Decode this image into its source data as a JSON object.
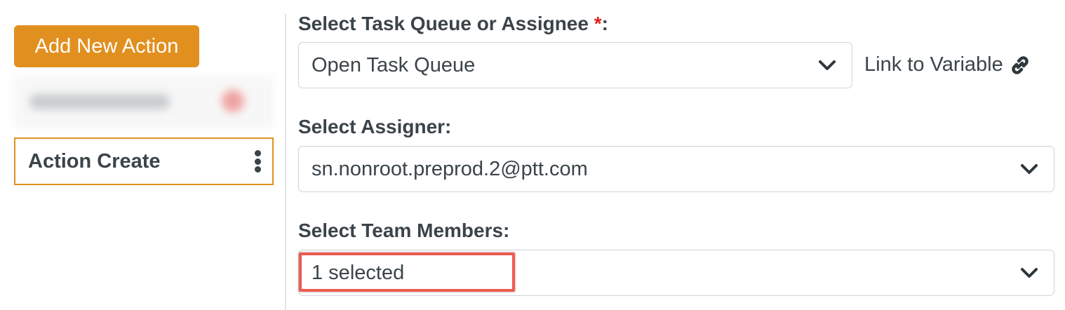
{
  "sidebar": {
    "add_button_label": "Add New Action",
    "selected_item_label": "Action Create"
  },
  "form": {
    "task_queue": {
      "label": "Select Task Queue or Assignee",
      "required_marker": "*",
      "label_suffix": ":",
      "value": "Open Task Queue",
      "link_label": "Link to Variable"
    },
    "assigner": {
      "label": "Select Assigner:",
      "value": "sn.nonroot.preprod.2@ptt.com"
    },
    "team_members": {
      "label": "Select Team Members:",
      "value": "1 selected"
    }
  },
  "colors": {
    "accent": "#e1901f",
    "text": "#3b4449",
    "required": "#e02020",
    "highlight": "#f05a4f"
  },
  "icons": {
    "dropdown": "chevron-down-icon",
    "link": "link-icon",
    "menu": "kebab-menu-icon"
  }
}
